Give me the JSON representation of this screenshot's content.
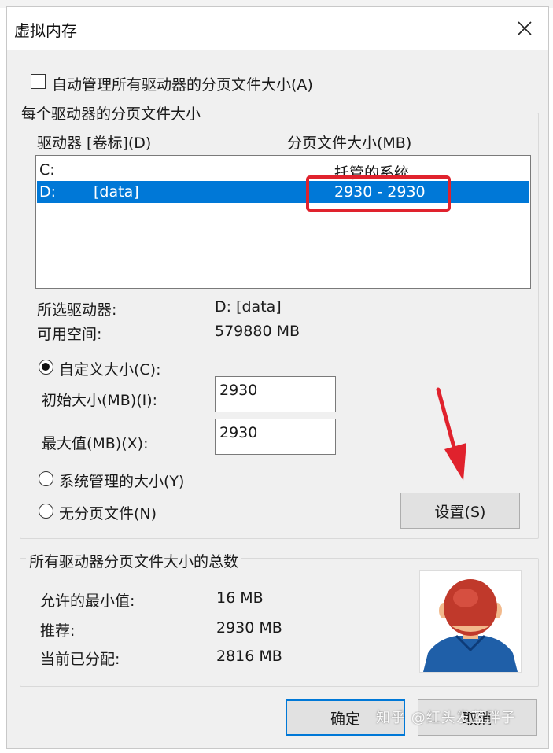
{
  "window": {
    "title": "虚拟内存"
  },
  "auto_manage": {
    "label": "自动管理所有驱动器的分页文件大小(A)",
    "checked": false
  },
  "per_drive_group": {
    "legend": "每个驱动器的分页文件大小",
    "headers": {
      "drive": "驱动器 [卷标](D)",
      "size": "分页文件大小(MB)"
    },
    "rows": [
      {
        "drive": "C:",
        "label": "",
        "size": "托管的系统",
        "selected": false
      },
      {
        "drive": "D:",
        "label": "[data]",
        "size": "2930 - 2930",
        "selected": true
      }
    ],
    "selected_drive_label": "所选驱动器:",
    "selected_drive_value": "D:  [data]",
    "free_space_label": "可用空间:",
    "free_space_value": "579880 MB",
    "custom_size": {
      "label": "自定义大小(C):",
      "checked": true
    },
    "initial_size": {
      "label": "初始大小(MB)(I):",
      "value": "2930"
    },
    "max_size": {
      "label": "最大值(MB)(X):",
      "value": "2930"
    },
    "system_managed": {
      "label": "系统管理的大小(Y)",
      "checked": false
    },
    "no_paging_file": {
      "label": "无分页文件(N)",
      "checked": false
    },
    "set_button": "设置(S)"
  },
  "totals_group": {
    "legend": "所有驱动器分页文件大小的总数",
    "min_allowed_label": "允许的最小值:",
    "min_allowed_value": "16 MB",
    "recommended_label": "推荐:",
    "recommended_value": "2930 MB",
    "allocated_label": "当前已分配:",
    "allocated_value": "2816 MB"
  },
  "footer": {
    "ok_label": "确定",
    "cancel_label": "取消"
  },
  "watermark": "知乎 @红头发蓝胖子",
  "colors": {
    "selection": "#0078d7",
    "annotation_red": "#e0222d",
    "avatar_hair": "#c0392b",
    "avatar_shirt": "#1f5fa8"
  },
  "icons": [
    "close-icon",
    "arrow-annotation",
    "avatar-illustration"
  ]
}
